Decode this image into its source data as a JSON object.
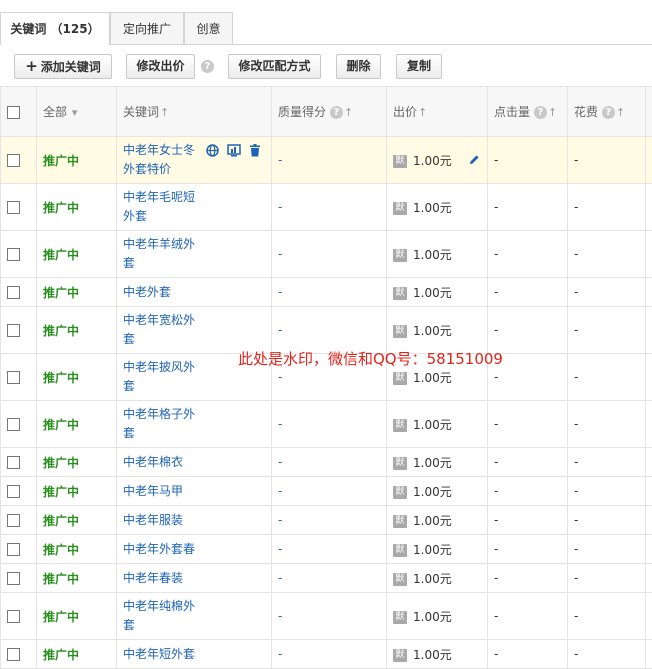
{
  "tabs": [
    {
      "label": "关键词 （125）"
    },
    {
      "label": "定向推广"
    },
    {
      "label": "创意"
    }
  ],
  "toolbar": {
    "add_keyword": "添加关键词",
    "modify_bid": "修改出价",
    "modify_match": "修改匹配方式",
    "delete": "删除",
    "copy": "复制"
  },
  "table": {
    "headers": {
      "all": "全部",
      "keyword": "关键词",
      "quality": "质量得分",
      "bid": "出价",
      "clicks": "点击量",
      "cost": "花费"
    },
    "rows": [
      {
        "status": "推广中",
        "keyword": "中老年女士冬外套特价",
        "quality": "-",
        "bid": "1.00元",
        "clicks": "-",
        "cost": "-"
      },
      {
        "status": "推广中",
        "keyword": "中老年毛呢短外套",
        "quality": "-",
        "bid": "1.00元",
        "clicks": "-",
        "cost": "-"
      },
      {
        "status": "推广中",
        "keyword": "中老年羊绒外套",
        "quality": "-",
        "bid": "1.00元",
        "clicks": "-",
        "cost": "-"
      },
      {
        "status": "推广中",
        "keyword": "中老外套",
        "quality": "-",
        "bid": "1.00元",
        "clicks": "-",
        "cost": "-"
      },
      {
        "status": "推广中",
        "keyword": "中老年宽松外套",
        "quality": "-",
        "bid": "1.00元",
        "clicks": "-",
        "cost": "-"
      },
      {
        "status": "推广中",
        "keyword": "中老年披风外套",
        "quality": "-",
        "bid": "1.00元",
        "clicks": "-",
        "cost": "-"
      },
      {
        "status": "推广中",
        "keyword": "中老年格子外套",
        "quality": "-",
        "bid": "1.00元",
        "clicks": "-",
        "cost": "-"
      },
      {
        "status": "推广中",
        "keyword": "中老年棉衣",
        "quality": "-",
        "bid": "1.00元",
        "clicks": "-",
        "cost": "-"
      },
      {
        "status": "推广中",
        "keyword": "中老年马甲",
        "quality": "-",
        "bid": "1.00元",
        "clicks": "-",
        "cost": "-"
      },
      {
        "status": "推广中",
        "keyword": "中老年服装",
        "quality": "-",
        "bid": "1.00元",
        "clicks": "-",
        "cost": "-"
      },
      {
        "status": "推广中",
        "keyword": "中老年外套春",
        "quality": "-",
        "bid": "1.00元",
        "clicks": "-",
        "cost": "-"
      },
      {
        "status": "推广中",
        "keyword": "中老年春装",
        "quality": "-",
        "bid": "1.00元",
        "clicks": "-",
        "cost": "-"
      },
      {
        "status": "推广中",
        "keyword": "中老年纯棉外套",
        "quality": "-",
        "bid": "1.00元",
        "clicks": "-",
        "cost": "-"
      },
      {
        "status": "推广中",
        "keyword": "中老年短外套",
        "quality": "-",
        "bid": "1.00元",
        "clicks": "-",
        "cost": "-"
      }
    ]
  },
  "watermark": "此处是水印，微信和QQ号：58151009",
  "colors": {
    "status_green": "#2b8f1f",
    "link_blue": "#1e63b5",
    "watermark_red": "#e2231a",
    "highlight_row": "#fffbe4"
  }
}
